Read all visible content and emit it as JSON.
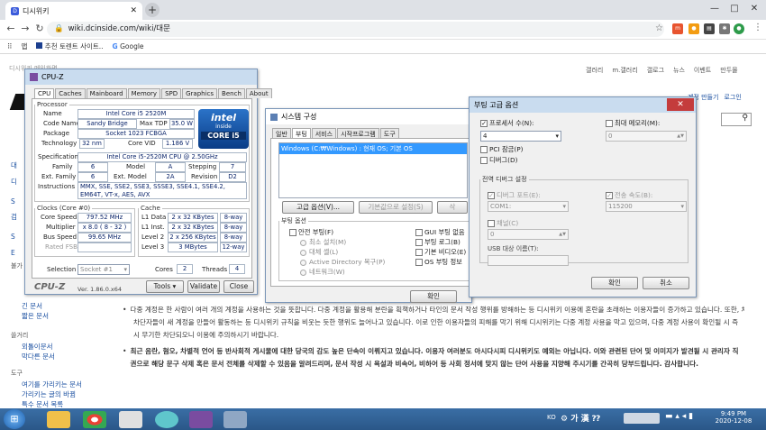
{
  "browser": {
    "tab_title": "디시위키",
    "url": "wiki.dcinside.com/wiki/대문",
    "window_controls": [
      "—",
      "□",
      "✕"
    ]
  },
  "bookmarks": [
    "앱",
    "추천 토렌트 사이트..",
    "Google"
  ],
  "site": {
    "topnav": [
      "갤러리",
      "m.갤러리",
      "갤로그",
      "뉴스",
      "이벤트",
      "만두몰"
    ],
    "login": "로그인",
    "register": "계정 만들기",
    "side_groups": [
      {
        "title": "불가",
        "items": [
          "긴 문서",
          "짧은 문서"
        ]
      },
      {
        "title": "쓸거리",
        "items": [
          "외톨이문서",
          "막다른 문서"
        ]
      },
      {
        "title": "도구",
        "items": [
          "여기를 가리키는 문서",
          "가리키는 글의 바뀜",
          "특수 문서 목록"
        ]
      }
    ],
    "side_partial": [
      "대",
      "디",
      "S",
      "검",
      "S",
      "E"
    ],
    "bullets": [
      "다중 계정은 한 사람이 여러 개의 계정을 사용하는 것을 뜻합니다. 다중 계정을 활용해 분란을 획책하거나 타인의 문서 작성 행위를 방해하는 등 디시위키 이용에 혼란을 초래하는 이용자들이 증가하고 있습니다. 또한, 차단자들이 새 계정을 만들어 활동하는 등 디시위키 규칙을 비웃는 듯한 행위도 늘어나고 있습니다. 이로 인한 이용자들의 피해를 막기 위해 디시위키는 다중 계정 사용을 막고 있으며, 다중 계정 사용이 확인될 시 즉시 무기한 차단되오니 이용에 주의하시기 바랍니다.",
      "최근 음란, 혐오, 차별적 언어 등 반사회적 게시물에 대한 당국의 감도 높은 단속이 이뤄지고 있습니다. 이용자 여러분도 아시다시피 디시위키도 예외는 아닙니다. 이와 관련된 단어 및 이미지가 발견될 시 관리자 직권으로 해당 문구 삭제 혹은 문서 전체를 삭제할 수 있음을 알려드리며, 문서 작성 시 욕설과 비속어, 비하어 등 사회 정서에 맞지 않는 단어 사용을 지양해 주시기를 간곡히 당부드립니다. 감사합니다."
    ]
  },
  "cpuz": {
    "title": "CPU-Z",
    "tabs": [
      "CPU",
      "Caches",
      "Mainboard",
      "Memory",
      "SPD",
      "Graphics",
      "Bench",
      "About"
    ],
    "processor": {
      "legend": "Processor",
      "name_lbl": "Name",
      "name": "Intel Core i5 2520M",
      "codename_lbl": "Code Name",
      "codename": "Sandy Bridge",
      "maxtdp_lbl": "Max TDP",
      "maxtdp": "35.0 W",
      "package_lbl": "Package",
      "package": "Socket 1023 FCBGA",
      "tech_lbl": "Technology",
      "tech": "32 nm",
      "vid_lbl": "Core VID",
      "vid": "1.186 V",
      "spec_lbl": "Specification",
      "spec": "Intel Core i5-2520M CPU @ 2.50GHz",
      "family_lbl": "Family",
      "family": "6",
      "model_lbl": "Model",
      "model": "A",
      "stepping_lbl": "Stepping",
      "stepping": "7",
      "extfam_lbl": "Ext. Family",
      "extfam": "6",
      "extmodel_lbl": "Ext. Model",
      "extmodel": "2A",
      "revision_lbl": "Revision",
      "revision": "D2",
      "instr_lbl": "Instructions",
      "instr": "MMX, SSE, SSE2, SSE3, SSSE3, SSE4.1, SSE4.2, EM64T, VT-x, AES, AVX"
    },
    "logo": {
      "brand": "intel",
      "sub": "inside",
      "model": "CORE i5"
    },
    "clocks": {
      "legend": "Clocks (Core #0)",
      "speed_lbl": "Core Speed",
      "speed": "797.52 MHz",
      "mult_lbl": "Multiplier",
      "mult": "x 8.0 ( 8 - 32 )",
      "bus_lbl": "Bus Speed",
      "bus": "99.65 MHz",
      "fsb_lbl": "Rated FSB"
    },
    "cache": {
      "legend": "Cache",
      "rows": [
        {
          "l": "L1 Data",
          "v": "2 x 32 KBytes",
          "w": "8-way"
        },
        {
          "l": "L1 Inst.",
          "v": "2 x 32 KBytes",
          "w": "8-way"
        },
        {
          "l": "Level 2",
          "v": "2 x 256 KBytes",
          "w": "8-way"
        },
        {
          "l": "Level 3",
          "v": "3 MBytes",
          "w": "12-way"
        }
      ]
    },
    "selection_lbl": "Selection",
    "selection": "Socket #1",
    "cores_lbl": "Cores",
    "cores": "2",
    "threads_lbl": "Threads",
    "threads": "4",
    "footer_brand": "CPU-Z",
    "version": "Ver. 1.86.0.x64",
    "tools": "Tools",
    "validate": "Validate",
    "close": "Close"
  },
  "sysconfig": {
    "title": "시스템 구성",
    "tabs": [
      "일반",
      "부팅",
      "서비스",
      "시작프로그램",
      "도구"
    ],
    "boot_entry": "Windows (C:₩Windows) : 현재 OS; 기본 OS",
    "adv_btn": "고급 옵션(V)...",
    "default_btn": "기본값으로 설정(S)",
    "delete_btn": "삭",
    "boot_opts": "부팅 옵션",
    "safeboot": "안전 부팅(F)",
    "minimal": "최소 설치(M)",
    "altshell": "대체 셸(L)",
    "ad": "Active Directory 복구(P)",
    "network": "네트워크(W)",
    "nogui": "GUI 부팅 없음",
    "bootlog": "부팅 로그(B)",
    "basevideo": "기본 비디오(E)",
    "osinfo": "OS 부팅 정보",
    "ok": "확인"
  },
  "bootadv": {
    "title": "부팅 고급 옵션",
    "numproc": "프로세서 수(N):",
    "numproc_val": "4",
    "maxmem": "최대 메모리(M):",
    "maxmem_val": "0",
    "pcilock": "PCI 잠금(P)",
    "debug": "디버그(D)",
    "global_debug": "전역 디버그 설정",
    "debugport": "디버그 포트(E):",
    "debugport_val": "COM1:",
    "baud": "전송 속도(B):",
    "baud_val": "115200",
    "channel": "채널(C)",
    "channel_val": "0",
    "usb": "USB 대상 이름(T):",
    "ok": "확인",
    "cancel": "취소"
  },
  "taskbar": {
    "ime": "KO",
    "time": "9:49 PM",
    "date": "2020-12-08"
  }
}
